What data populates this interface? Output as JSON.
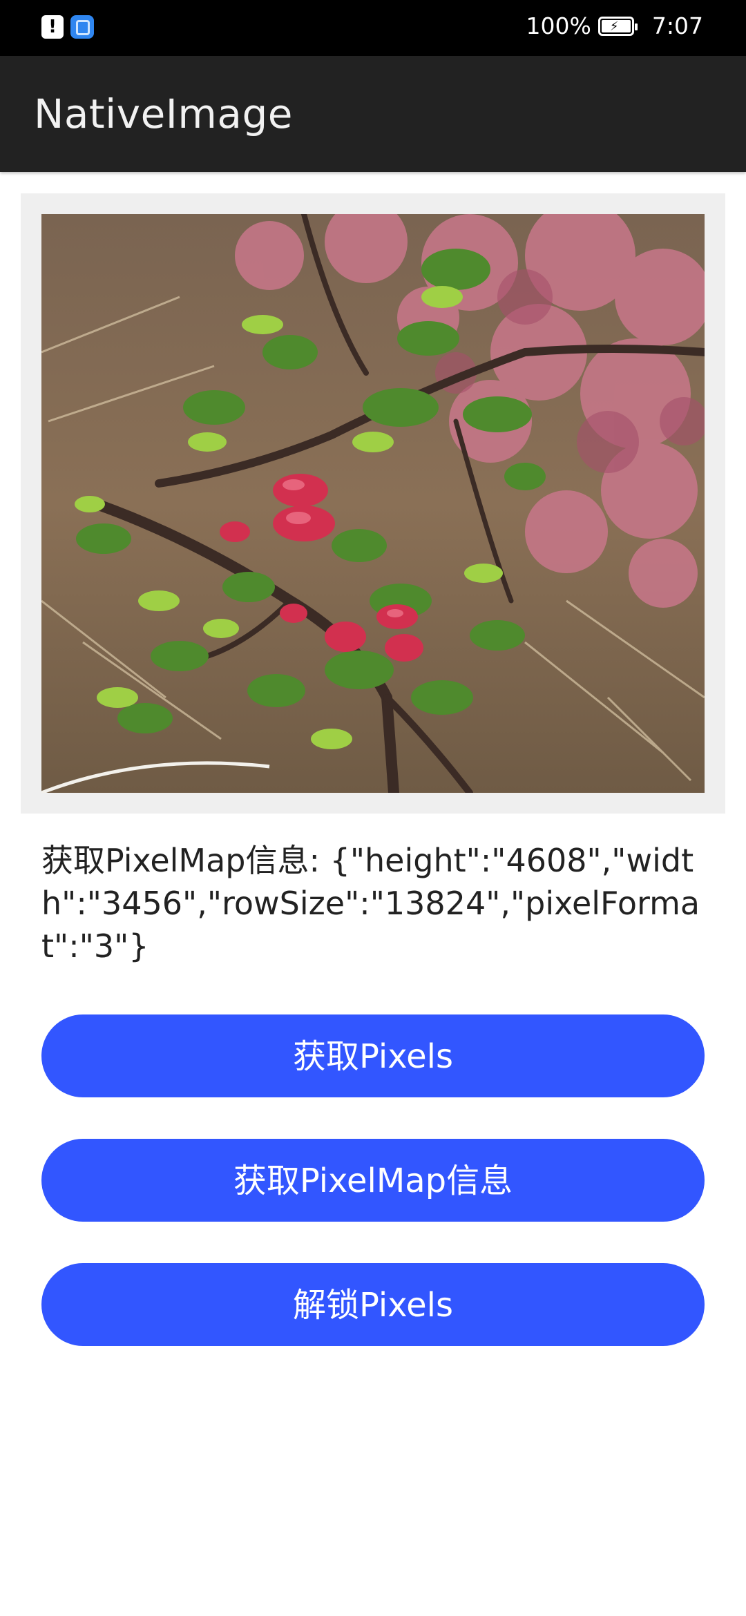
{
  "status_bar": {
    "battery_percent": "100%",
    "time": "7:07",
    "left_icons": [
      "alert-icon",
      "app-notification-icon"
    ]
  },
  "app_bar": {
    "title": "NativeImage"
  },
  "image": {
    "description_icon": "flowering-branch-photo"
  },
  "info": {
    "text": "获取PixelMap信息: {\"height\":\"4608\",\"width\":\"3456\",\"rowSize\":\"13824\",\"pixelFormat\":\"3\"}"
  },
  "buttons": {
    "get_pixels": "获取Pixels",
    "get_pixelmap_info": "获取PixelMap信息",
    "unlock_pixels": "解锁Pixels"
  },
  "colors": {
    "button_bg": "#3256ff",
    "app_bar_bg": "#222222",
    "status_bar_bg": "#000000"
  }
}
